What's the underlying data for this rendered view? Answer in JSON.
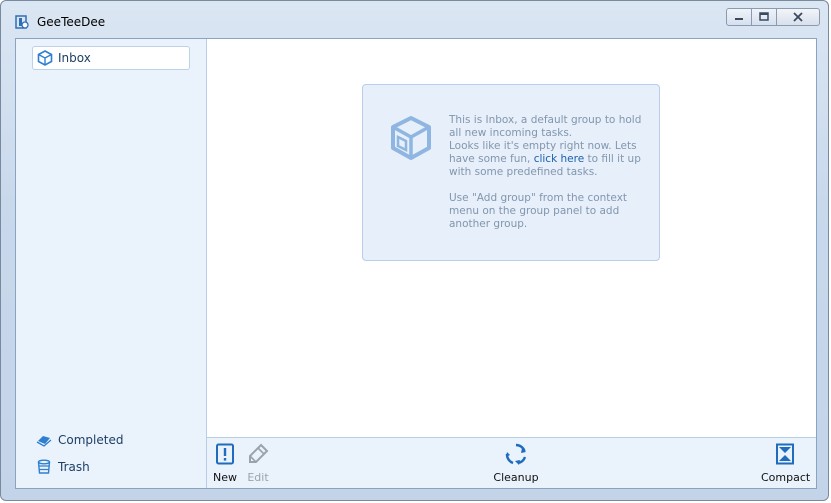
{
  "window": {
    "title": "GeeTeeDee"
  },
  "sidebar": {
    "groups": [
      {
        "label": "Inbox",
        "icon": "box-icon"
      }
    ],
    "bottom": [
      {
        "label": "Completed",
        "icon": "completed-icon"
      },
      {
        "label": "Trash",
        "icon": "trash-icon"
      }
    ]
  },
  "info": {
    "line1": "This is Inbox, a default group to hold all new incoming tasks.",
    "line2_pre": "Looks like it's empty right now. Lets have some fun, ",
    "line2_link": "click here",
    "line2_post": " to fill it up with some predefined tasks.",
    "line3": "Use \"Add group\" from the context menu on the group panel to add another group."
  },
  "toolbar": {
    "new_label": "New",
    "edit_label": "Edit",
    "cleanup_label": "Cleanup",
    "compact_label": "Compact"
  },
  "colors": {
    "accent": "#2e7fd0",
    "link": "#1b5fae",
    "panel": "#eaf2fc"
  }
}
